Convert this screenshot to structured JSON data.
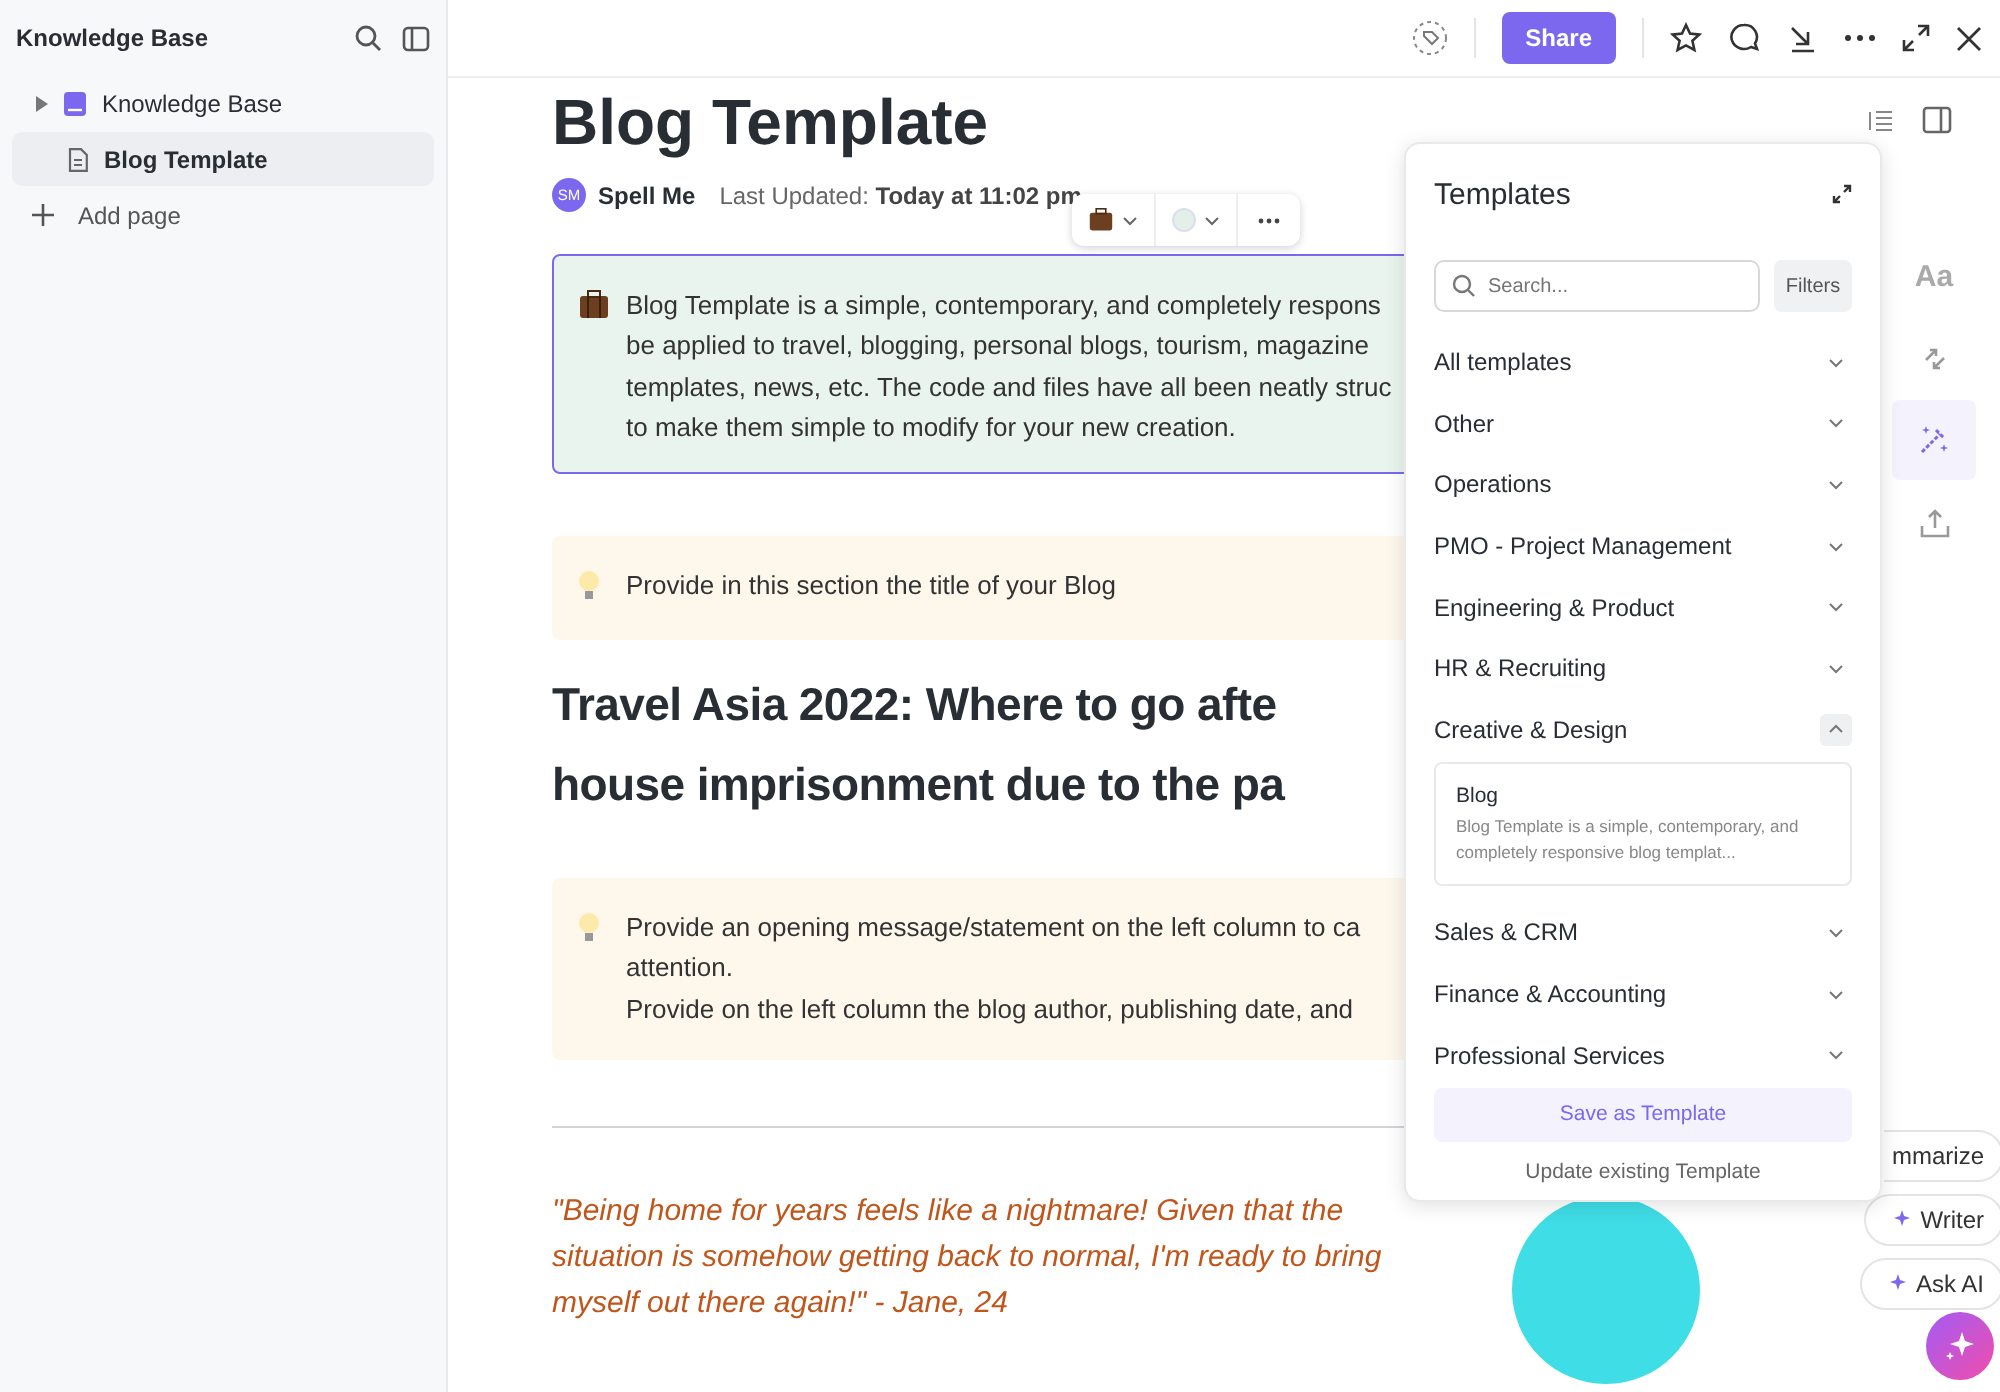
{
  "sidebar": {
    "title": "Knowledge Base",
    "items": [
      {
        "label": "Knowledge Base",
        "kind": "space",
        "selected": false
      },
      {
        "label": "Blog Template",
        "kind": "page",
        "selected": true
      }
    ],
    "add_page": "Add page"
  },
  "topbar": {
    "share": "Share"
  },
  "doc": {
    "title": "Blog Template",
    "author": {
      "initials": "SM",
      "name": "Spell Me"
    },
    "updated_label": "Last Updated:",
    "updated": "Today at 11:02 pm",
    "intro_lines": [
      "Blog Template is a simple, contemporary, and completely respons",
      "be applied to travel, blogging, personal blogs, tourism, magazine",
      "templates, news, etc. The code and files have all been neatly struc",
      "to make them simple to modify for your new creation."
    ],
    "callout_title": [
      "Provide in this section the title of your Blog"
    ],
    "heading_lines": [
      "Travel Asia 2022: Where to go afte",
      "house imprisonment due to the pa"
    ],
    "callout_opening": [
      "Provide an opening message/statement on the left column to ca",
      "attention.",
      "Provide on the left column the blog author, publishing date, and"
    ],
    "quote": "\"Being home for years feels like a nightmare! Given that the situation is somehow getting back to normal, I'm ready to bring myself out there again!\" - Jane, 24"
  },
  "rail": [
    {
      "kind": "font",
      "label": "Aa",
      "selected": false
    },
    {
      "kind": "convert",
      "selected": false
    },
    {
      "kind": "templates",
      "selected": true
    },
    {
      "kind": "export",
      "selected": false
    }
  ],
  "templates_panel": {
    "title": "Templates",
    "search_placeholder": "Search...",
    "filters": "Filters",
    "categories": [
      {
        "label": "All templates",
        "expanded": false
      },
      {
        "label": "Other",
        "expanded": false
      },
      {
        "label": "Operations",
        "expanded": false
      },
      {
        "label": "PMO - Project Management",
        "expanded": false
      },
      {
        "label": "Engineering & Product",
        "expanded": false
      },
      {
        "label": "HR & Recruiting",
        "expanded": false
      },
      {
        "label": "Creative & Design",
        "expanded": true,
        "templates": [
          {
            "title": "Blog",
            "description": "Blog Template is a simple, contemporary, and completely responsive blog templat..."
          }
        ]
      },
      {
        "label": "Sales & CRM",
        "expanded": false
      },
      {
        "label": "Finance & Accounting",
        "expanded": false
      },
      {
        "label": "Professional Services",
        "expanded": false
      }
    ],
    "save": "Save as Template",
    "update": "Update existing Template"
  },
  "ai_buttons": [
    "mmarize",
    "Writer",
    "Ask AI"
  ]
}
